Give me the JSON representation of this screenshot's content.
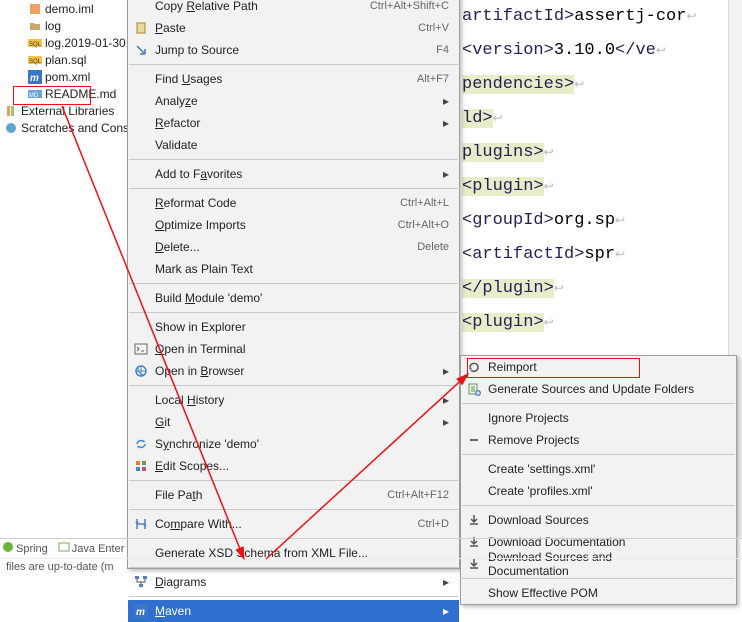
{
  "sidebar": {
    "items": [
      {
        "icon": "orange",
        "label": "demo.iml"
      },
      {
        "icon": "folder",
        "label": "log"
      },
      {
        "icon": "sql",
        "label": "log.2019-01-30."
      },
      {
        "icon": "sql",
        "label": "plan.sql"
      },
      {
        "icon": "maven",
        "label": "pom.xml"
      },
      {
        "icon": "md",
        "label": "README.md"
      },
      {
        "icon": "lib",
        "label": "External Libraries"
      },
      {
        "icon": "scratch",
        "label": "Scratches and Cons"
      }
    ]
  },
  "context_menu": {
    "items": [
      {
        "label": "Copy Relative Path",
        "shortcut": "Ctrl+Alt+Shift+C",
        "u": 5
      },
      {
        "label": "Paste",
        "shortcut": "Ctrl+V",
        "icon": "paste",
        "u": 0
      },
      {
        "label": "Jump to Source",
        "shortcut": "F4",
        "icon": "arrow-dr"
      },
      {
        "type": "sep"
      },
      {
        "label": "Find Usages",
        "shortcut": "Alt+F7",
        "u": 5
      },
      {
        "label": "Analyze",
        "submenu": true,
        "u": 5
      },
      {
        "label": "Refactor",
        "submenu": true,
        "u": 0
      },
      {
        "label": "Validate"
      },
      {
        "type": "sep"
      },
      {
        "label": "Add to Favorites",
        "submenu": true,
        "u": 8
      },
      {
        "type": "sep"
      },
      {
        "label": "Reformat Code",
        "shortcut": "Ctrl+Alt+L",
        "u": 0
      },
      {
        "label": "Optimize Imports",
        "shortcut": "Ctrl+Alt+O",
        "u": 0
      },
      {
        "label": "Delete...",
        "shortcut": "Delete",
        "u": 0
      },
      {
        "label": "Mark as Plain Text"
      },
      {
        "type": "sep"
      },
      {
        "label": "Build Module 'demo'",
        "u": 6
      },
      {
        "type": "sep"
      },
      {
        "label": "Show in Explorer"
      },
      {
        "label": "Open in Terminal",
        "icon": "terminal",
        "u": 0
      },
      {
        "label": "Open in Browser",
        "submenu": true,
        "icon": "globe",
        "u": 8
      },
      {
        "type": "sep"
      },
      {
        "label": "Local History",
        "submenu": true,
        "u": 6
      },
      {
        "label": "Git",
        "submenu": true,
        "u": 0
      },
      {
        "label": "Synchronize 'demo'",
        "icon": "sync",
        "u": 1
      },
      {
        "label": "Edit Scopes...",
        "icon": "scopes",
        "u": 0
      },
      {
        "type": "sep"
      },
      {
        "label": "File Path",
        "shortcut": "Ctrl+Alt+F12",
        "u": 7
      },
      {
        "type": "sep"
      },
      {
        "label": "Compare With...",
        "shortcut": "Ctrl+D",
        "icon": "compare",
        "u": 2
      },
      {
        "type": "sep"
      },
      {
        "label": "Generate XSD Schema from XML File...",
        "u": 9
      },
      {
        "type": "sep"
      },
      {
        "label": "Diagrams",
        "submenu": true,
        "icon": "diagram",
        "u": 0
      },
      {
        "type": "sep"
      },
      {
        "label": "Maven",
        "submenu": true,
        "icon": "maven",
        "sel": true,
        "u": 0
      }
    ]
  },
  "submenu": {
    "items": [
      {
        "label": "Reimport",
        "icon": "reload"
      },
      {
        "label": "Generate Sources and Update Folders",
        "icon": "gen"
      },
      {
        "type": "sep"
      },
      {
        "label": "Ignore Projects"
      },
      {
        "label": "Remove Projects",
        "icon": "minus"
      },
      {
        "type": "sep"
      },
      {
        "label": "Create 'settings.xml'"
      },
      {
        "label": "Create 'profiles.xml'"
      },
      {
        "type": "sep"
      },
      {
        "label": "Download Sources",
        "icon": "dl"
      },
      {
        "label": "Download Documentation",
        "icon": "dl"
      },
      {
        "label": "Download Sources and Documentation",
        "icon": "dl"
      },
      {
        "type": "sep"
      },
      {
        "label": "Show Effective POM"
      }
    ]
  },
  "editor": {
    "lines": [
      {
        "pre": "artifactId>",
        "text": "assertj-cor"
      },
      {
        "pre": "<version>",
        "text": "3.10.0",
        "post": "</ve"
      },
      {
        "pre": "pendencies>",
        "text": ""
      },
      {
        "pre": "ld>",
        "text": ""
      },
      {
        "pre": "plugins>",
        "text": ""
      },
      {
        "pre": "<plugin>",
        "text": ""
      },
      {
        "pre": "    <groupId>",
        "text": "org.sp"
      },
      {
        "pre": "    <artifactId>",
        "text": "spr"
      },
      {
        "pre": "</plugin>",
        "text": ""
      },
      {
        "pre": "<plugin>",
        "text": ""
      }
    ]
  },
  "bottom_bar": {
    "spring": "Spring",
    "java": "Java Enter"
  },
  "status": "files are up-to-date (m"
}
